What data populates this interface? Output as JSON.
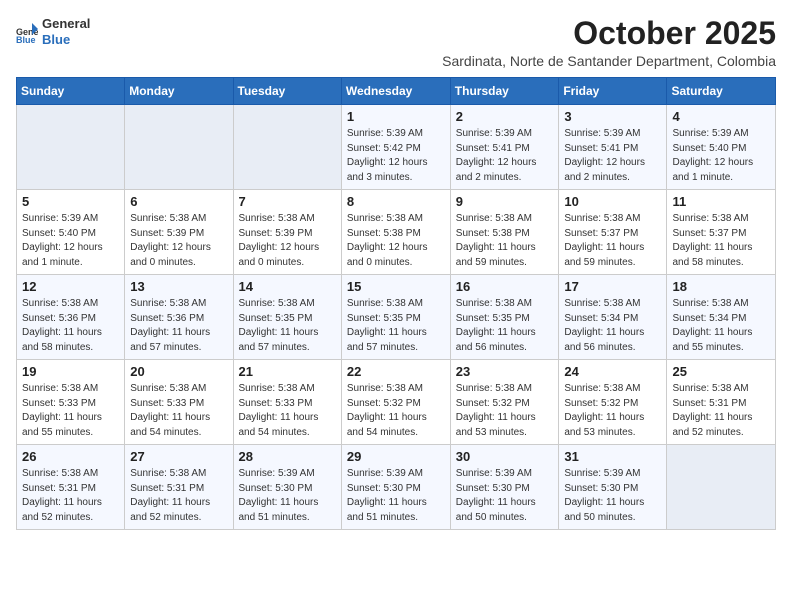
{
  "header": {
    "logo_general": "General",
    "logo_blue": "Blue",
    "month_title": "October 2025",
    "subtitle": "Sardinata, Norte de Santander Department, Colombia"
  },
  "days_of_week": [
    "Sunday",
    "Monday",
    "Tuesday",
    "Wednesday",
    "Thursday",
    "Friday",
    "Saturday"
  ],
  "weeks": [
    [
      {
        "day": "",
        "info": ""
      },
      {
        "day": "",
        "info": ""
      },
      {
        "day": "",
        "info": ""
      },
      {
        "day": "1",
        "info": "Sunrise: 5:39 AM\nSunset: 5:42 PM\nDaylight: 12 hours and 3 minutes."
      },
      {
        "day": "2",
        "info": "Sunrise: 5:39 AM\nSunset: 5:41 PM\nDaylight: 12 hours and 2 minutes."
      },
      {
        "day": "3",
        "info": "Sunrise: 5:39 AM\nSunset: 5:41 PM\nDaylight: 12 hours and 2 minutes."
      },
      {
        "day": "4",
        "info": "Sunrise: 5:39 AM\nSunset: 5:40 PM\nDaylight: 12 hours and 1 minute."
      }
    ],
    [
      {
        "day": "5",
        "info": "Sunrise: 5:39 AM\nSunset: 5:40 PM\nDaylight: 12 hours and 1 minute."
      },
      {
        "day": "6",
        "info": "Sunrise: 5:38 AM\nSunset: 5:39 PM\nDaylight: 12 hours and 0 minutes."
      },
      {
        "day": "7",
        "info": "Sunrise: 5:38 AM\nSunset: 5:39 PM\nDaylight: 12 hours and 0 minutes."
      },
      {
        "day": "8",
        "info": "Sunrise: 5:38 AM\nSunset: 5:38 PM\nDaylight: 12 hours and 0 minutes."
      },
      {
        "day": "9",
        "info": "Sunrise: 5:38 AM\nSunset: 5:38 PM\nDaylight: 11 hours and 59 minutes."
      },
      {
        "day": "10",
        "info": "Sunrise: 5:38 AM\nSunset: 5:37 PM\nDaylight: 11 hours and 59 minutes."
      },
      {
        "day": "11",
        "info": "Sunrise: 5:38 AM\nSunset: 5:37 PM\nDaylight: 11 hours and 58 minutes."
      }
    ],
    [
      {
        "day": "12",
        "info": "Sunrise: 5:38 AM\nSunset: 5:36 PM\nDaylight: 11 hours and 58 minutes."
      },
      {
        "day": "13",
        "info": "Sunrise: 5:38 AM\nSunset: 5:36 PM\nDaylight: 11 hours and 57 minutes."
      },
      {
        "day": "14",
        "info": "Sunrise: 5:38 AM\nSunset: 5:35 PM\nDaylight: 11 hours and 57 minutes."
      },
      {
        "day": "15",
        "info": "Sunrise: 5:38 AM\nSunset: 5:35 PM\nDaylight: 11 hours and 57 minutes."
      },
      {
        "day": "16",
        "info": "Sunrise: 5:38 AM\nSunset: 5:35 PM\nDaylight: 11 hours and 56 minutes."
      },
      {
        "day": "17",
        "info": "Sunrise: 5:38 AM\nSunset: 5:34 PM\nDaylight: 11 hours and 56 minutes."
      },
      {
        "day": "18",
        "info": "Sunrise: 5:38 AM\nSunset: 5:34 PM\nDaylight: 11 hours and 55 minutes."
      }
    ],
    [
      {
        "day": "19",
        "info": "Sunrise: 5:38 AM\nSunset: 5:33 PM\nDaylight: 11 hours and 55 minutes."
      },
      {
        "day": "20",
        "info": "Sunrise: 5:38 AM\nSunset: 5:33 PM\nDaylight: 11 hours and 54 minutes."
      },
      {
        "day": "21",
        "info": "Sunrise: 5:38 AM\nSunset: 5:33 PM\nDaylight: 11 hours and 54 minutes."
      },
      {
        "day": "22",
        "info": "Sunrise: 5:38 AM\nSunset: 5:32 PM\nDaylight: 11 hours and 54 minutes."
      },
      {
        "day": "23",
        "info": "Sunrise: 5:38 AM\nSunset: 5:32 PM\nDaylight: 11 hours and 53 minutes."
      },
      {
        "day": "24",
        "info": "Sunrise: 5:38 AM\nSunset: 5:32 PM\nDaylight: 11 hours and 53 minutes."
      },
      {
        "day": "25",
        "info": "Sunrise: 5:38 AM\nSunset: 5:31 PM\nDaylight: 11 hours and 52 minutes."
      }
    ],
    [
      {
        "day": "26",
        "info": "Sunrise: 5:38 AM\nSunset: 5:31 PM\nDaylight: 11 hours and 52 minutes."
      },
      {
        "day": "27",
        "info": "Sunrise: 5:38 AM\nSunset: 5:31 PM\nDaylight: 11 hours and 52 minutes."
      },
      {
        "day": "28",
        "info": "Sunrise: 5:39 AM\nSunset: 5:30 PM\nDaylight: 11 hours and 51 minutes."
      },
      {
        "day": "29",
        "info": "Sunrise: 5:39 AM\nSunset: 5:30 PM\nDaylight: 11 hours and 51 minutes."
      },
      {
        "day": "30",
        "info": "Sunrise: 5:39 AM\nSunset: 5:30 PM\nDaylight: 11 hours and 50 minutes."
      },
      {
        "day": "31",
        "info": "Sunrise: 5:39 AM\nSunset: 5:30 PM\nDaylight: 11 hours and 50 minutes."
      },
      {
        "day": "",
        "info": ""
      }
    ]
  ]
}
